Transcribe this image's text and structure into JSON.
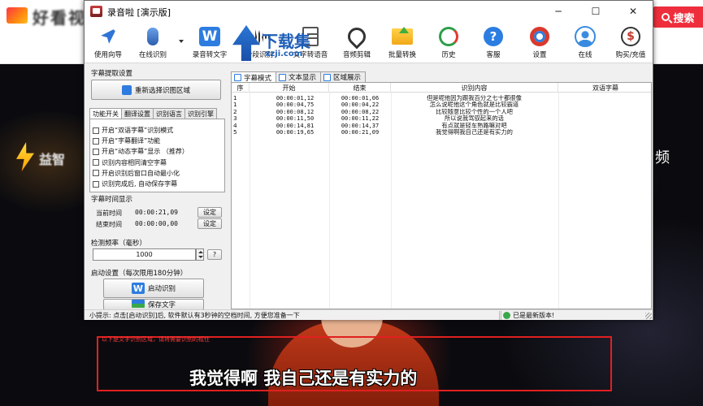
{
  "background": {
    "site_logo_text": "好看视",
    "search_button_label": "搜索",
    "video_logo_text": "益智",
    "video_side_text": "频",
    "capture_hint": "以下是文字识别区域，请将需要识别的框住",
    "video_subtitle": "我觉得啊 我自己还是有实力的"
  },
  "window": {
    "title": "录音啦 [演示版]",
    "minimize_glyph": "─",
    "maximize_glyph": "☐",
    "close_glyph": "✕"
  },
  "toolbar": {
    "items": [
      {
        "label": "使用向导",
        "icon": "navigation-icon"
      },
      {
        "label": "在线识别",
        "icon": "microphone-icon"
      },
      {
        "label": "录音转文字",
        "icon": "word-icon"
      },
      {
        "label": "分段识别",
        "icon": "waveform-icon"
      },
      {
        "label": "文字转语音",
        "icon": "document-icon"
      },
      {
        "label": "音频剪辑",
        "icon": "scissors-icon"
      },
      {
        "label": "批量转换",
        "icon": "folder-icon"
      },
      {
        "label": "历史",
        "icon": "history-icon"
      },
      {
        "label": "客服",
        "icon": "help-icon"
      },
      {
        "label": "设置",
        "icon": "settings-ring-icon"
      },
      {
        "label": "在线",
        "icon": "user-icon"
      },
      {
        "label": "购买/充值",
        "icon": "coin-icon"
      }
    ],
    "word_glyph": "W",
    "help_glyph": "?",
    "coin_glyph": "$"
  },
  "watermark": {
    "text": "下载集",
    "url": "xzji.com"
  },
  "left": {
    "extract_title": "字幕提取设置",
    "reselect_label": "重新选择识图区域",
    "tabs": [
      "功能开关",
      "翻译设置",
      "识别语言",
      "识别引擎"
    ],
    "options": [
      "开启“双语字幕”识别模式",
      "开启“字幕翻译”功能",
      "开启“动态字幕”显示   （推荐）",
      "识别内容相同清空字幕",
      "开启识别后窗口自动最小化",
      "识别完成后, 自动保存字幕"
    ],
    "time_title": "字幕时间显示",
    "current_label": "当前时间",
    "current_value": "00:00:21,09",
    "end_label": "结束时间",
    "end_value": "00:00:00,00",
    "set_label": "设定",
    "freq_title": "检测频率（毫秒）",
    "freq_value": "1000",
    "freq_help": "?",
    "start_title": "启动设置（每次限用180分钟）",
    "start_label": "启动识别",
    "save_label": "保存文字",
    "start_glyph": "W"
  },
  "right": {
    "tabs": [
      "字幕模式",
      "文本显示",
      "区域展示"
    ],
    "columns": [
      "序",
      "开始",
      "结束",
      "识别内容",
      "双语字幕"
    ],
    "rows": [
      {
        "seq": "1",
        "start": "00:00:01,12",
        "end": "00:00:01,06",
        "text": "但是呢他因为跟我百分之七十都很像",
        "bi": ""
      },
      {
        "seq": "1",
        "start": "00:00:04,75",
        "end": "00:00:04,22",
        "text": "怎么说呢他这个角色就是比较霸道",
        "bi": ""
      },
      {
        "seq": "2",
        "start": "00:00:08,12",
        "end": "00:00:08,22",
        "text": "比较随意比较个性的一个人吧",
        "bi": ""
      },
      {
        "seq": "3",
        "start": "00:00:11,50",
        "end": "00:00:11,22",
        "text": "所以说我驾驭起来的话",
        "bi": ""
      },
      {
        "seq": "4",
        "start": "00:00:14,81",
        "end": "00:00:14,37",
        "text": "有点就是轻车熟路嘛对吧",
        "bi": ""
      },
      {
        "seq": "5",
        "start": "00:00:19,65",
        "end": "00:00:21,09",
        "text": "我觉得啊我自己还是有实力的",
        "bi": ""
      }
    ]
  },
  "status": {
    "hint": "小提示: 点击[启动识别]后, 软件默认有3秒钟的空档时间, 方便您准备一下",
    "version": "已是最新版本!"
  },
  "colors": {
    "accent_blue": "#2b7de1",
    "capture_red": "#e02020",
    "search_red": "#ee2e3c"
  }
}
